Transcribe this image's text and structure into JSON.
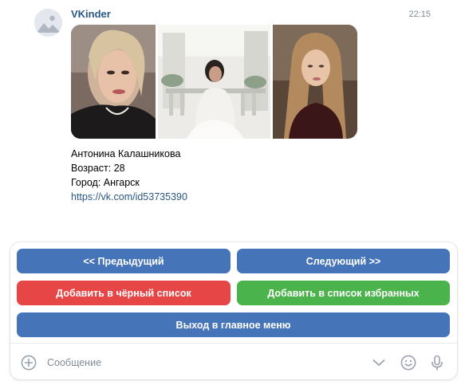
{
  "message": {
    "sender": "VKinder",
    "time": "22:15",
    "profile": {
      "name": "Антонина Калашникова",
      "age": "Возраст: 28",
      "city": "Город: Ангарск",
      "link": "https://vk.com/id53735390"
    },
    "photos_count": 3
  },
  "keyboard": {
    "prev": "<< Предыдущий",
    "next": "Следующий >>",
    "blacklist": "Добавить в чёрный список",
    "favorites": "Добавить в список избранных",
    "menu": "Выход в главное меню"
  },
  "composer": {
    "placeholder": "Сообщение"
  },
  "icons": {
    "attach": "plus-circle-icon",
    "collapse": "chevron-down-icon",
    "emoji": "smile-icon",
    "voice": "microphone-icon"
  },
  "colors": {
    "link": "#2a5885",
    "time": "#818c99",
    "button_primary": "#4674b9",
    "button_negative": "#e64646",
    "button_positive": "#4bb34b",
    "icon": "#99a2ad"
  }
}
